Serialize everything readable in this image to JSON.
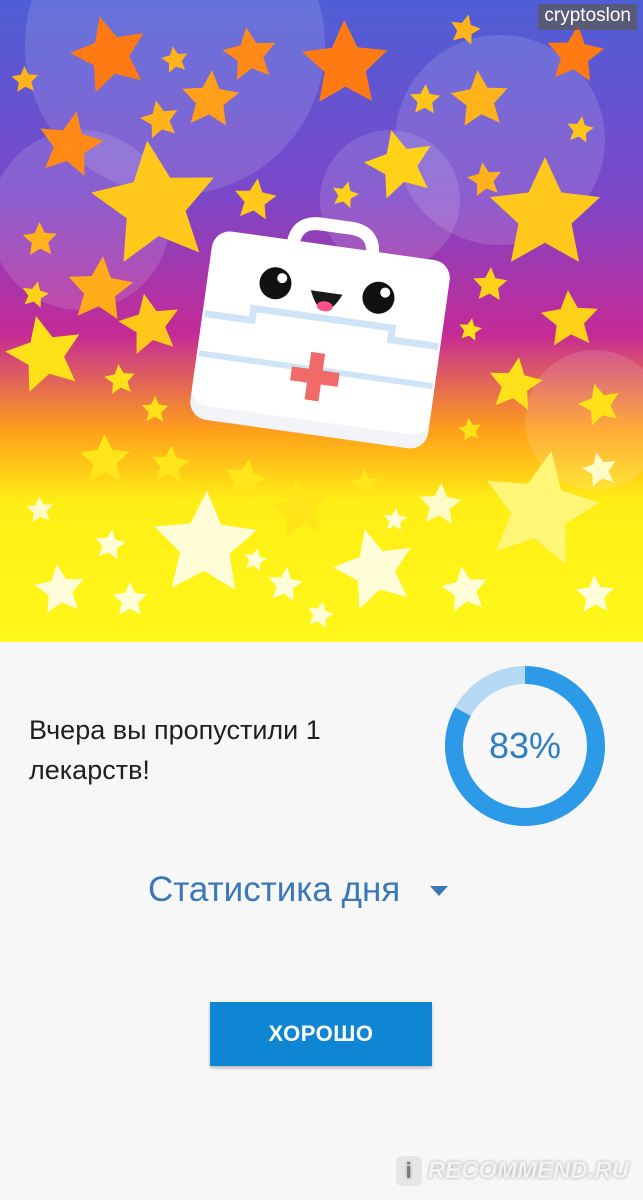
{
  "watermark_top": "cryptoslon",
  "hero": {
    "illustration": "first-aid-kit-mascot-with-stars",
    "colors": {
      "top": "#4e5fd6",
      "middle": "#c42a96",
      "bottom": "#fff81a",
      "kit": "#ffffff",
      "cross": "#f06a6a"
    }
  },
  "message": "Вчера вы пропустили 1 лекарств!",
  "progress": {
    "value": 83,
    "label": "83%",
    "color": "#2d9ae8",
    "track_color": "#b6d8f3"
  },
  "stats": {
    "label": "Статистика дня",
    "icon": "dropdown-caret"
  },
  "ok_button": {
    "label": "ХОРОШО",
    "color": "#0e86d4"
  },
  "watermark_bottom": {
    "badge": "i",
    "text": "RECOMMEND.RU"
  }
}
